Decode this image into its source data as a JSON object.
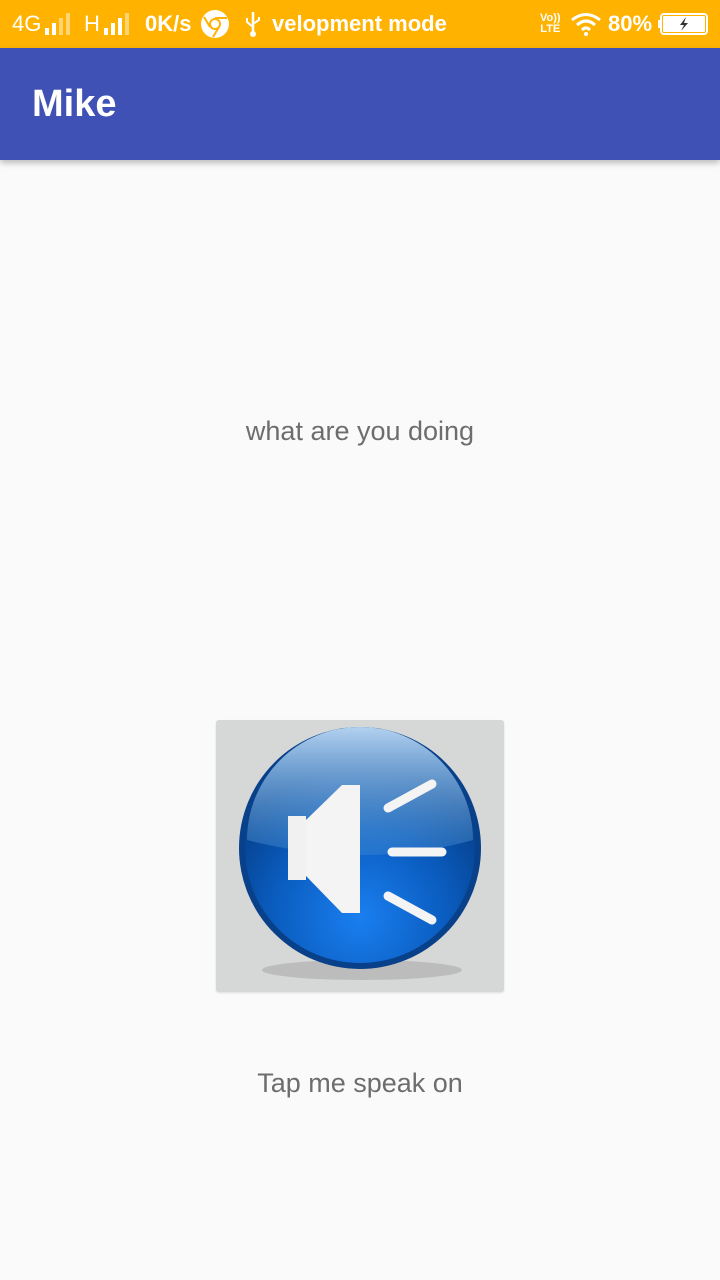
{
  "status_bar": {
    "network_type": "4G",
    "network_type_2": "H",
    "speed": "0K/s",
    "notification_text": "velopment mode",
    "volte_label_top": "Vo))",
    "volte_label_bottom": "LTE",
    "battery": "80%",
    "icons": [
      "signal-icon",
      "chrome-icon",
      "usb-icon",
      "volte-icon",
      "wifi-icon",
      "battery-icon"
    ],
    "color": "#ffb300"
  },
  "app_bar": {
    "title": "Mike",
    "color": "#3f51b5"
  },
  "main": {
    "spoken_text": "what are you doing",
    "speak_button_icon": "speaker-icon",
    "hint": "Tap me speak on"
  }
}
